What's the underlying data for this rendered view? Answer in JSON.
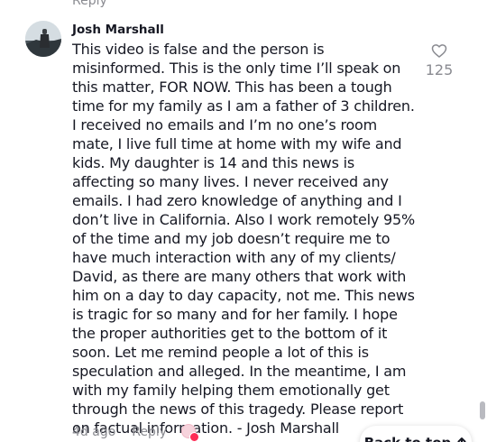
{
  "previous_comment": {
    "reply_label": "Reply"
  },
  "comment": {
    "author": "Josh Marshall",
    "text": "This video is false and the person is misinformed. This is the only time I’ll speak on this matter, FOR NOW. This has been a tough time for my family as I am a father of 3 children. I received no emails and I’m no one’s room mate, I live full time at home with my wife and kids. My daughter is 14 and this news is affecting so many lives. I never received any emails. I had zero knowledge of anything and I don’t live in California. Also I work remotely 95% of the time and my job doesn’t require me to have much interaction with any of my clients/ David, as there are many others that work with him on a day to day capacity, not me. This news is tragic for so many and for her family. I hope the proper authorities get to the bottom of it soon. Let me remind people a lot of this is speculation and alleged. In the meantime, I am with my family helping them emotionally get through the news of this tragedy. Please report on factual information. - Josh Marshall",
    "timestamp": "4d ago",
    "reply_label": "Reply",
    "like_count": "125",
    "icons": {
      "like": "heart-outline-icon",
      "creator_liked": "creator-liked-badge-icon"
    }
  },
  "back_to_top": {
    "label": "Back to top",
    "icon": "arrow-up-icon"
  },
  "colors": {
    "text": "#161823",
    "secondary_text": "#8a8b91",
    "accent": "#fe2c55"
  }
}
